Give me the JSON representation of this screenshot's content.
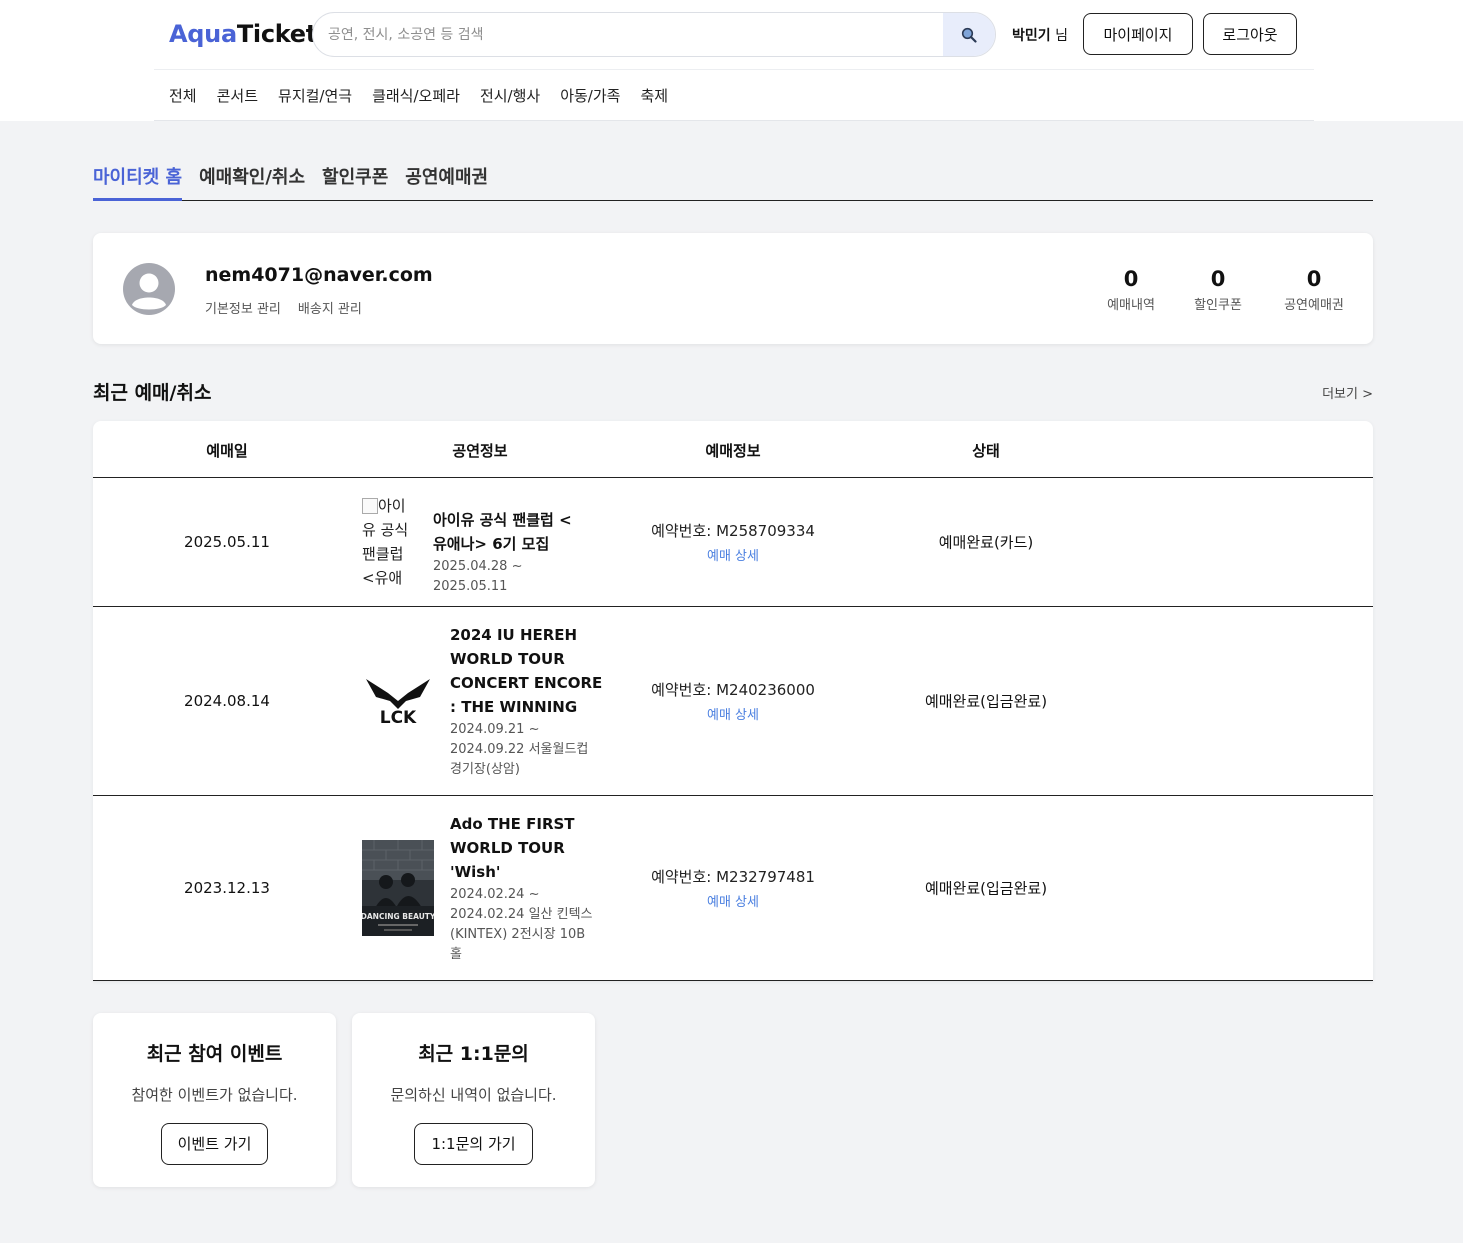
{
  "header": {
    "logo_part1": "Aqua",
    "logo_part2": "Ticket",
    "search_placeholder": "공연, 전시, 소공연 등 검색",
    "user_name": "박민기",
    "user_suffix": "님",
    "mypage_label": "마이페이지",
    "logout_label": "로그아웃",
    "categories": [
      "전체",
      "콘서트",
      "뮤지컬/연극",
      "클래식/오페라",
      "전시/행사",
      "아동/가족",
      "축제"
    ]
  },
  "tabs": [
    "마이티켓 홈",
    "예매확인/취소",
    "할인쿠폰",
    "공연예매권"
  ],
  "profile": {
    "email": "nem4071@naver.com",
    "links": [
      "기본정보 관리",
      "배송지 관리"
    ],
    "stats": [
      {
        "value": "0",
        "label": "예매내역"
      },
      {
        "value": "0",
        "label": "할인쿠폰"
      },
      {
        "value": "0",
        "label": "공연예매권"
      }
    ]
  },
  "recent": {
    "title": "최근 예매/취소",
    "more": "더보기 >",
    "columns": [
      "예매일",
      "공연정보",
      "예매정보",
      "상태"
    ],
    "rows": [
      {
        "date": "2025.05.11",
        "img_alt": "아이유 공식 팬클럽 <유애",
        "title_l1": "아이유 공식 팬클럽 <",
        "title_l2": "유애나> 6기 모집",
        "period_l1": "2025.04.28 ~ 2025.05.11",
        "res_no": "예약번호: M258709334",
        "detail": "예매 상세",
        "status": "예매완료(카드)"
      },
      {
        "date": "2024.08.14",
        "title_lines": [
          "2024 IU HEREH",
          "WORLD TOUR",
          "CONCERT ENCORE",
          ": THE WINNING"
        ],
        "period_lines": [
          "2024.09.21 ~",
          "2024.09.22 서울월드컵",
          "경기장(상암)"
        ],
        "res_no": "예약번호: M240236000",
        "detail": "예매 상세",
        "status": "예매완료(입금완료)",
        "logo_text": "LCK"
      },
      {
        "date": "2023.12.13",
        "title_lines": [
          "Ado THE FIRST",
          "WORLD TOUR",
          "'Wish'"
        ],
        "period_lines": [
          "2024.02.24 ~",
          "2024.02.24 일산 킨텍스",
          "(KINTEX) 2전시장 10B",
          "홀"
        ],
        "res_no": "예약번호: M232797481",
        "detail": "예매 상세",
        "status": "예매완료(입금완료)",
        "poster_text": "DANCING BEAUTY"
      }
    ]
  },
  "cards": [
    {
      "title": "최근 참여 이벤트",
      "desc": "참여한 이벤트가 없습니다.",
      "button": "이벤트 가기"
    },
    {
      "title": "최근 1:1문의",
      "desc": "문의하신 내역이 없습니다.",
      "button": "1:1문의 가기"
    }
  ]
}
